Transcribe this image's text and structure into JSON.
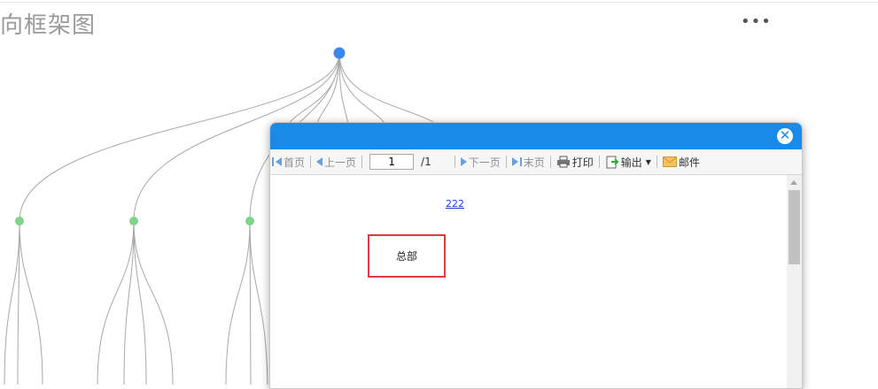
{
  "page": {
    "title": "向框架图",
    "more_label": "•••"
  },
  "dialog": {
    "close_label": "✕",
    "toolbar": {
      "first": "首页",
      "prev": "上一页",
      "page_value": "1",
      "page_total": "/1",
      "next": "下一页",
      "last": "末页",
      "print": "打印",
      "export": "输出",
      "mail": "邮件"
    },
    "content": {
      "link_text": "222",
      "box_text": "总部"
    }
  },
  "colors": {
    "accent": "#1a8ae8",
    "root_node": "#3b86e6",
    "child_node": "#7fd48a",
    "highlight_border": "#e0393f"
  }
}
